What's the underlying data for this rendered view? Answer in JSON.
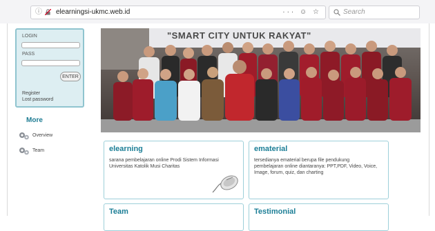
{
  "browser": {
    "url": "elearningsi-ukmc.web.id",
    "url_actions": "··· ☺ ☆",
    "search_placeholder": "Search"
  },
  "login": {
    "login_label": "LOGIN",
    "pass_label": "PASS",
    "enter_label": "ENTER",
    "register_label": "Register",
    "lost_password_label": "Lost password"
  },
  "menu": {
    "title": "More",
    "items": [
      {
        "label": "Overview",
        "icon": "gears-icon"
      },
      {
        "label": "Team",
        "icon": "gears-icon"
      }
    ]
  },
  "banner": {
    "caption": "\"SMART CITY UNTUK RAKYAT\""
  },
  "cards": [
    {
      "title": "elearning",
      "description": "sarana pembelajaran online Prodi Sistem Informasi Universitas Katolik Musi Charitas",
      "icon": "mouse-icon"
    },
    {
      "title": "ematerial",
      "description": "tersedianya ematerial berupa file pendukung pembelajaran online diantaranya: PPT,PDF, Video, Voice, Image, forum, quiz, dan charting",
      "icon": "camcorder-icon"
    },
    {
      "title": "Team"
    },
    {
      "title": "Testimonial"
    }
  ],
  "colors": {
    "accent": "#1c7e96",
    "login_bg": "#ddeef2",
    "card_border": "#9dcfd9"
  }
}
